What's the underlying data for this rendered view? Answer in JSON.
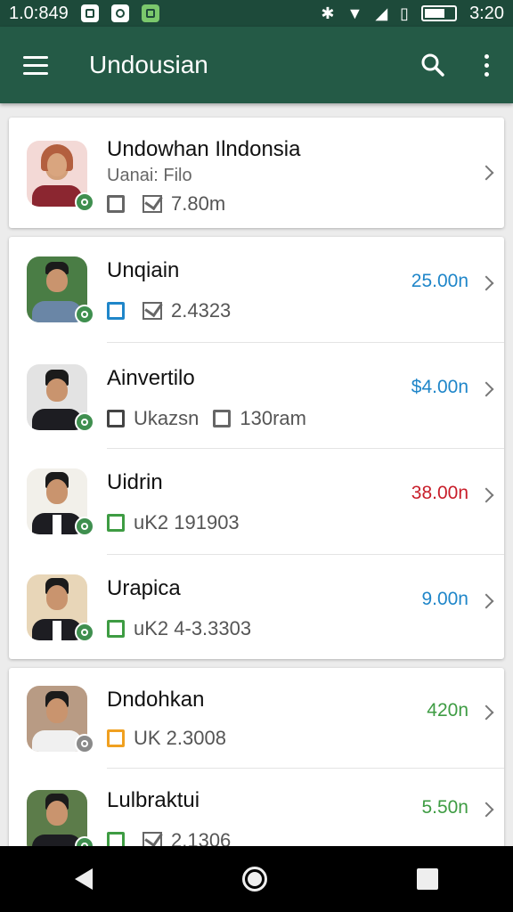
{
  "status_bar": {
    "time_left": "1.0:849",
    "time_right": "3:20"
  },
  "appbar": {
    "title": "Undousian"
  },
  "header_card": {
    "name": "Undowhan Ilndonsia",
    "subtitle": "Uanai: Filo",
    "meta": "7.80m"
  },
  "list": [
    {
      "name": "Unqiain",
      "meta": "2.4323",
      "price": "25.00n",
      "price_color": "#1f86c9",
      "icon_color": "blue"
    },
    {
      "name": "Ainvertilo",
      "meta_a": "Ukazsn",
      "meta_b": "130ram",
      "price": "$4.00n",
      "price_color": "#1f86c9",
      "icon_color": "dark"
    },
    {
      "name": "Uidrin",
      "meta": "uK2 191903",
      "price": "38.00n",
      "price_color": "#c81e2a",
      "icon_color": "green"
    },
    {
      "name": "Urapica",
      "meta": "uK2 4-3.3303",
      "price": "9.00n",
      "price_color": "#1f86c9",
      "icon_color": "green"
    },
    {
      "name": "Dndohkan",
      "meta": "UK  2.3008",
      "price": "420n",
      "price_color": "#3e9c43",
      "icon_color": "orange"
    },
    {
      "name": "Lulbraktui",
      "meta": "2.1306",
      "price": "5.50n",
      "price_color": "#3e9c43",
      "icon_color": "green"
    }
  ]
}
